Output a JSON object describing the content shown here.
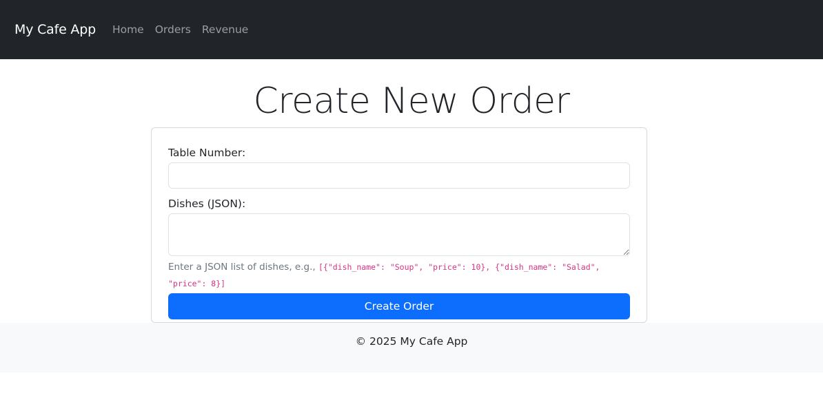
{
  "navbar": {
    "brand": "My Cafe App",
    "links": [
      {
        "label": "Home"
      },
      {
        "label": "Orders"
      },
      {
        "label": "Revenue"
      }
    ]
  },
  "main": {
    "title": "Create New Order",
    "form": {
      "table_label": "Table Number:",
      "table_value": "",
      "dishes_label": "Dishes (JSON):",
      "dishes_value": "",
      "help_prefix": "Enter a JSON list of dishes, e.g.,",
      "help_example": "[{\"dish_name\": \"Soup\", \"price\": 10}, {\"dish_name\": \"Salad\", \"price\": 8}]",
      "submit_label": "Create Order"
    }
  },
  "footer": {
    "text": "© 2025 My Cafe App"
  },
  "colors": {
    "navbar_bg": "#212529",
    "primary": "#0d6efd",
    "code": "#d63384",
    "footer_bg": "#f8f9fa"
  }
}
